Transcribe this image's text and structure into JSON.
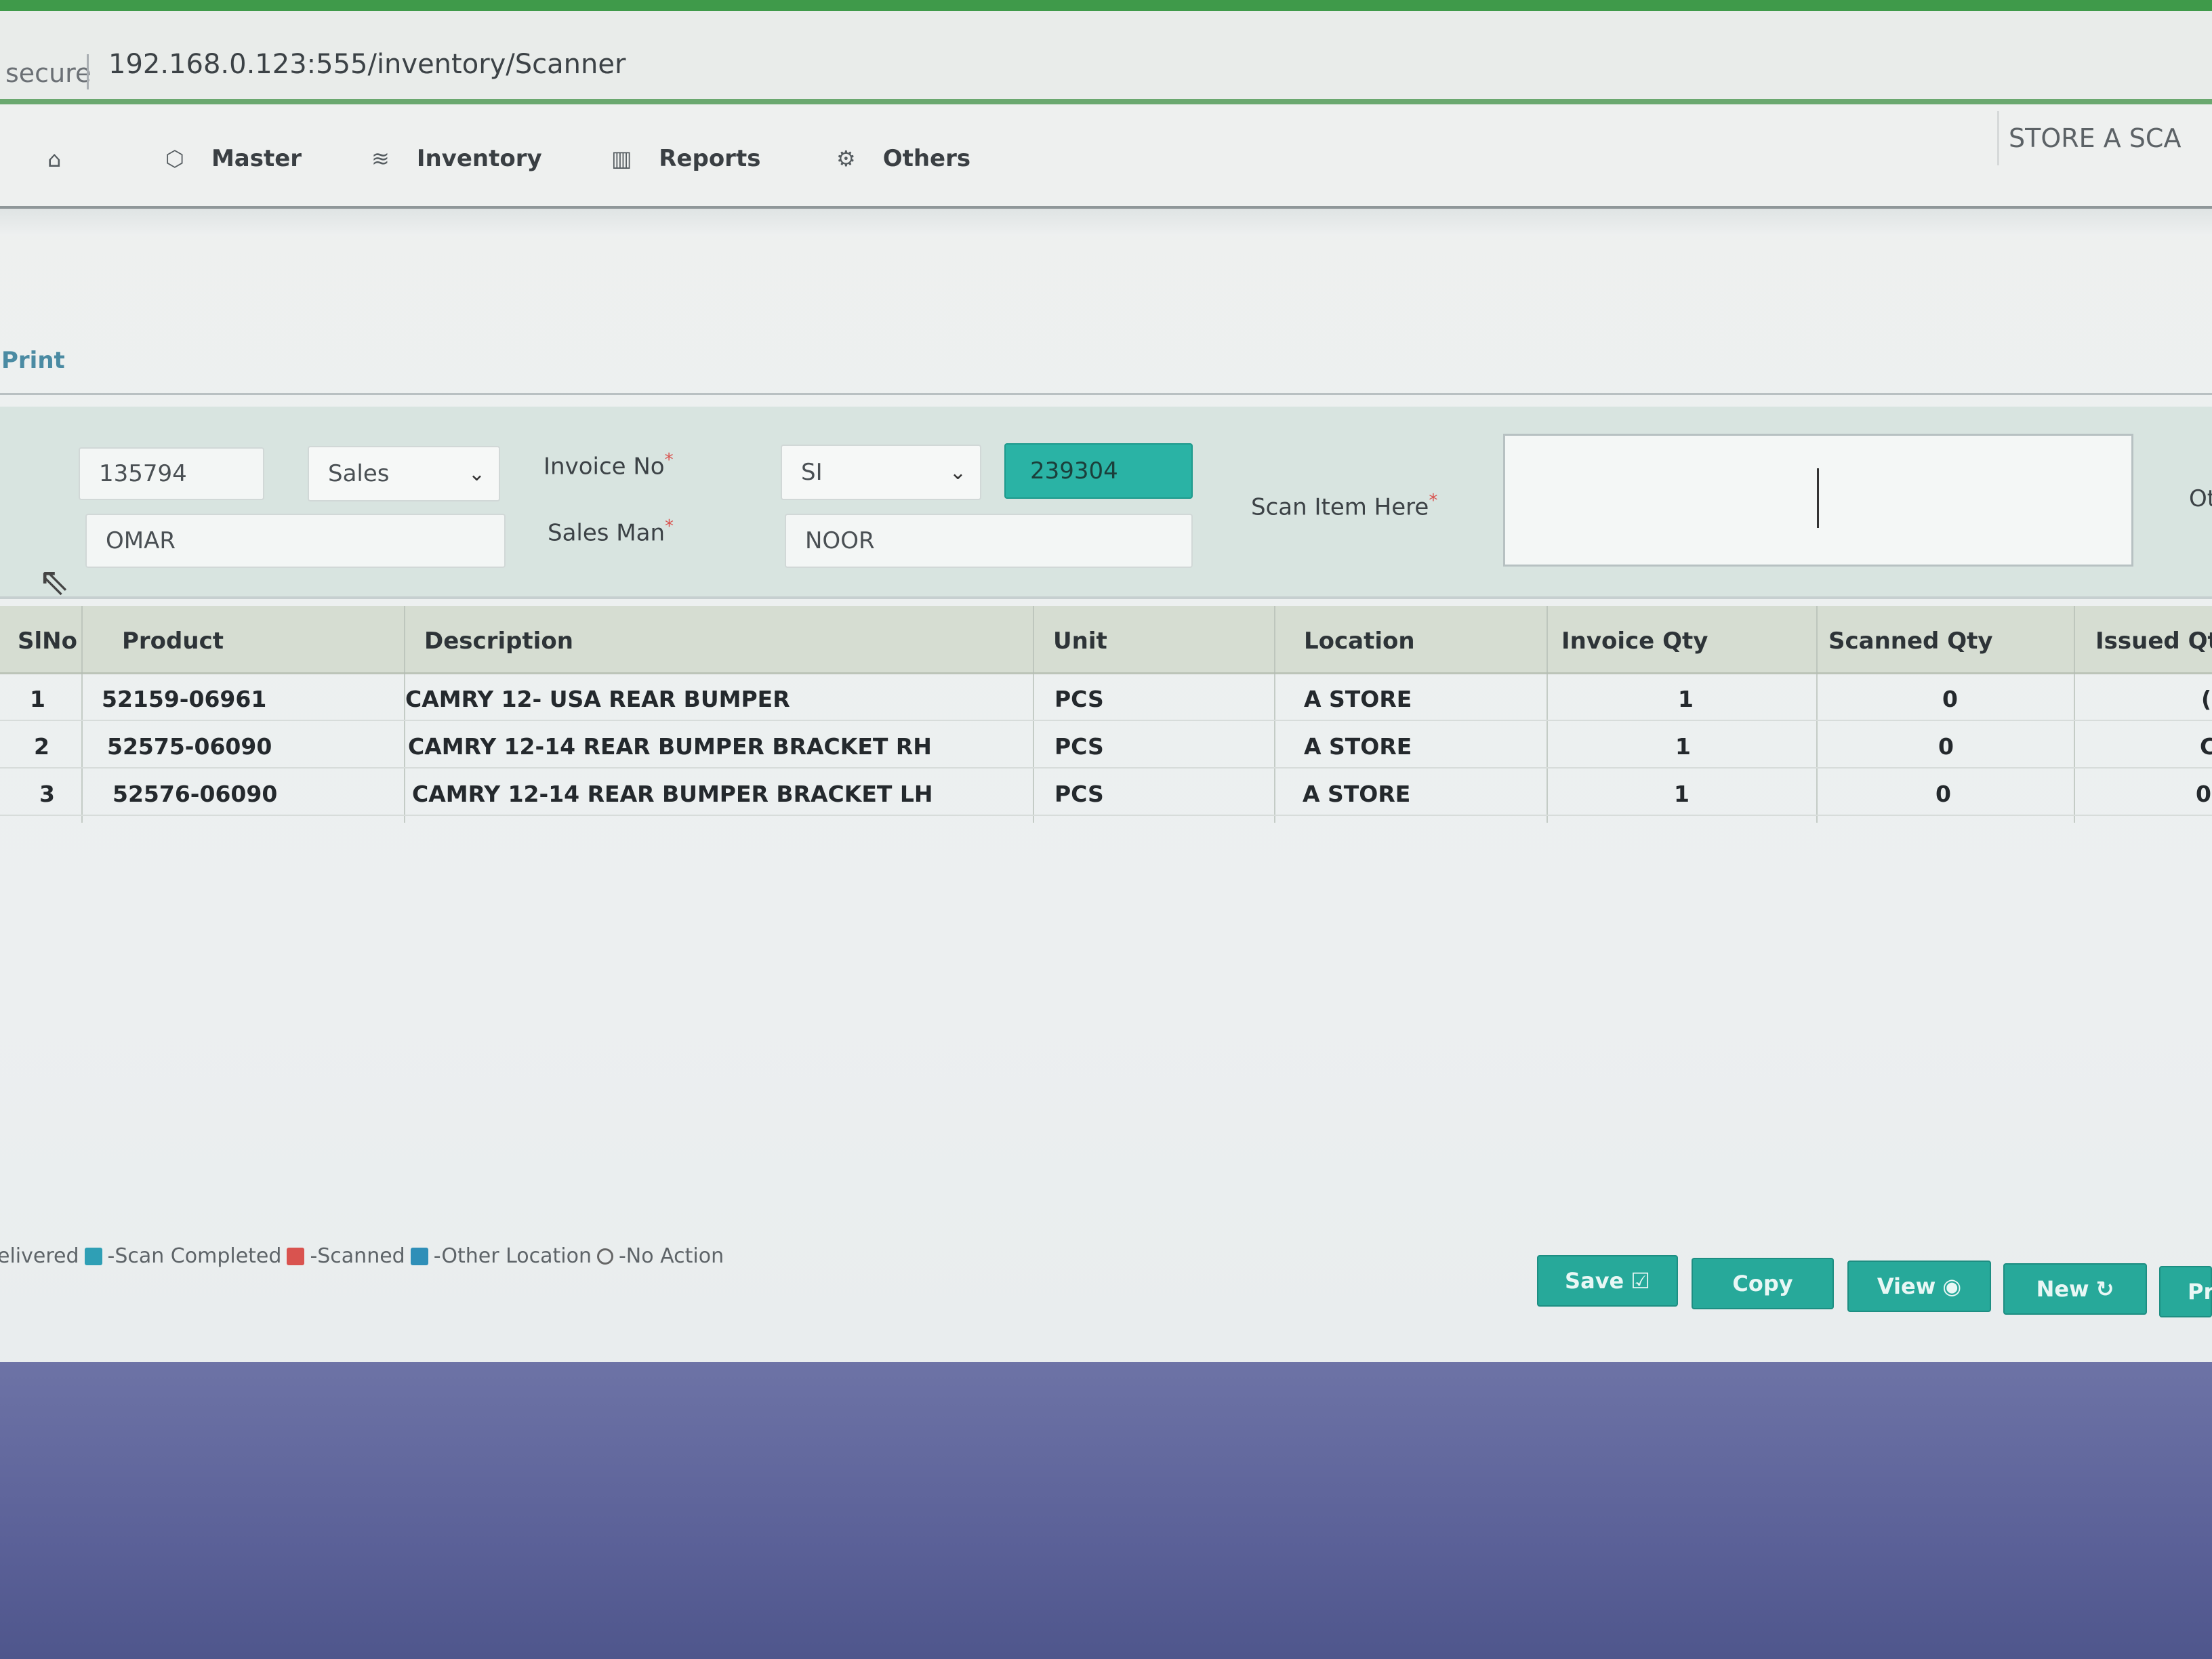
{
  "browser": {
    "secure_label": "secure",
    "url": "192.168.0.123:555/inventory/Scanner"
  },
  "nav": {
    "home_icon": "home-icon",
    "items": [
      {
        "label": "Master",
        "icon": "box-icon"
      },
      {
        "label": "Inventory",
        "icon": "layers-icon"
      },
      {
        "label": "Reports",
        "icon": "bar-chart-icon"
      },
      {
        "label": "Others",
        "icon": "gear-icon"
      }
    ],
    "store_label": "STORE A SCA"
  },
  "print_label": "Print",
  "form": {
    "doc_number": "135794",
    "type_select": "Sales",
    "invoice_label": "Invoice No",
    "invoice_prefix": "SI",
    "invoice_number": "239304",
    "customer": "OMAR",
    "salesman_label": "Sales Man",
    "salesman": "NOOR",
    "scan_label": "Scan Item Here",
    "scan_value": "",
    "cut_label": "Ot"
  },
  "table": {
    "headers": [
      "SlNo",
      "Product",
      "Description",
      "Unit",
      "Location",
      "Invoice Qty",
      "Scanned Qty",
      "Issued Qt"
    ],
    "rows": [
      {
        "slno": "1",
        "product": "52159-06961",
        "description": "CAMRY 12- USA REAR BUMPER",
        "unit": "PCS",
        "location": "A STORE",
        "invoice_qty": "1",
        "scanned_qty": "0",
        "issued_qty": "("
      },
      {
        "slno": "2",
        "product": "52575-06090",
        "description": "CAMRY 12-14 REAR BUMPER BRACKET RH",
        "unit": "PCS",
        "location": "A STORE",
        "invoice_qty": "1",
        "scanned_qty": "0",
        "issued_qty": "C"
      },
      {
        "slno": "3",
        "product": "52576-06090",
        "description": "CAMRY 12-14 REAR BUMPER BRACKET LH",
        "unit": "PCS",
        "location": "A STORE",
        "invoice_qty": "1",
        "scanned_qty": "0",
        "issued_qty": "0"
      }
    ]
  },
  "legend": {
    "delivered": "elivered",
    "scan_completed": "-Scan Completed",
    "scanned": "-Scanned",
    "other_location": "-Other Location",
    "no_action": "-No Action",
    "colors": {
      "delivered": "#2f9fb5",
      "scanned": "#d9534f",
      "other_location": "#2f8fb8"
    }
  },
  "buttons": {
    "save": "Save",
    "copy": "Copy",
    "view": "View",
    "new": "New",
    "print": "Pr"
  },
  "colors": {
    "accent": "#27a99a",
    "footer": "#5b6198",
    "browser_bar": "#3f9a4a"
  }
}
